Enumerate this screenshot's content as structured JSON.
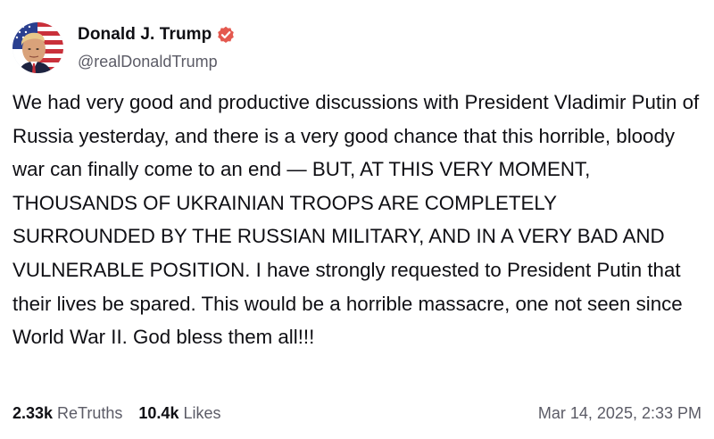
{
  "author": {
    "display_name": "Donald J. Trump",
    "handle": "@realDonaldTrump",
    "verified": true,
    "verified_color": "#e4594f",
    "avatar_icon": "profile-photo-flag"
  },
  "post": {
    "text": "We had very good and productive discussions with President Vladimir Putin of Russia yesterday, and there is a very good chance that this horrible, bloody war can finally come to an end — BUT, AT THIS VERY MOMENT, THOUSANDS OF UKRAINIAN TROOPS ARE COMPLETELY SURROUNDED BY THE RUSSIAN MILITARY, AND IN A VERY BAD AND VULNERABLE POSITION. I have strongly requested to President Putin that their lives be spared. This would be a horrible massacre, one not seen since World War II. God bless them all!!!"
  },
  "stats": {
    "retruths_count": "2.33k",
    "retruths_label": "ReTruths",
    "likes_count": "10.4k",
    "likes_label": "Likes"
  },
  "timestamp": "Mar 14, 2025, 2:33 PM"
}
